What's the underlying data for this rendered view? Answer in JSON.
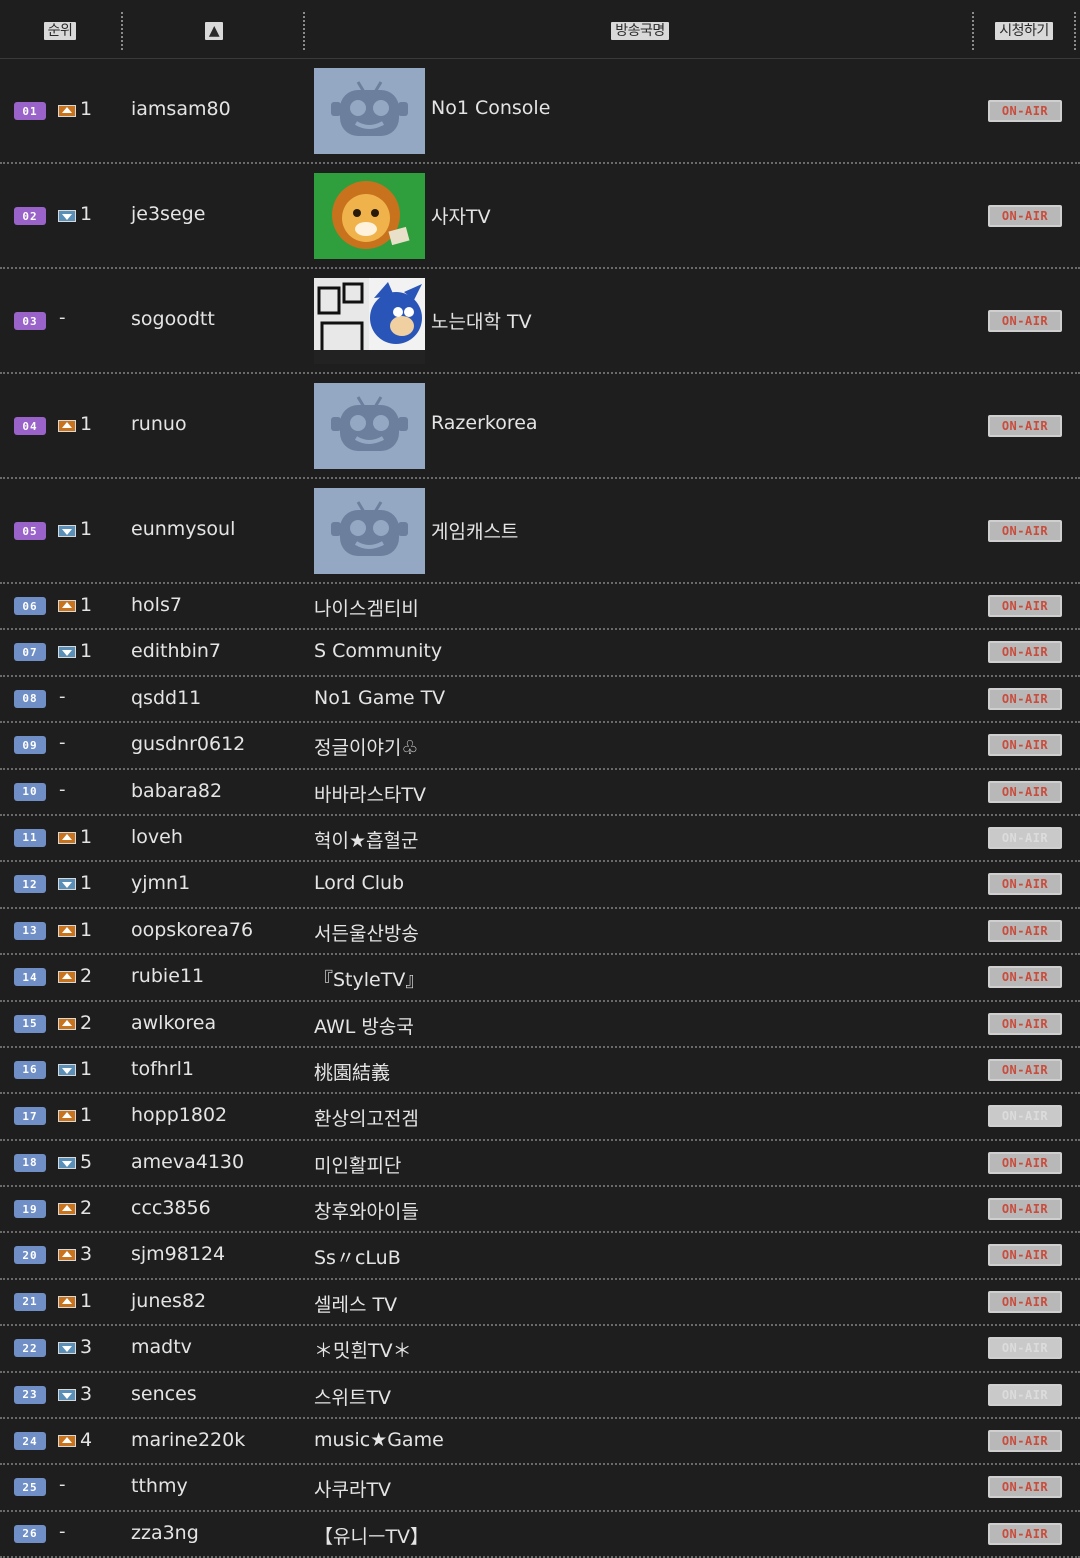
{
  "header": {
    "rank": "순위",
    "delta": "▲",
    "station": "방송국명",
    "watch": "시청하기"
  },
  "colors": {
    "purple_badge": "#9a63c9",
    "blue_badge": "#6f8fc6",
    "onair_red": "#c94c3c"
  },
  "rows": [
    {
      "rank": "01",
      "icon": "up-arrow-icon",
      "change": "1",
      "user": "iamsam80",
      "thumb": "tv-default",
      "station": "No1 Console",
      "onair": "ON-AIR",
      "active": true
    },
    {
      "rank": "02",
      "icon": "down-arrow-icon",
      "change": "1",
      "user": "je3sege",
      "thumb": "lion",
      "station": "사자TV",
      "onair": "ON-AIR",
      "active": true
    },
    {
      "rank": "03",
      "icon": "",
      "change": "-",
      "user": "sogoodtt",
      "thumb": "comic",
      "station": "노는대학 TV",
      "onair": "ON-AIR",
      "active": true
    },
    {
      "rank": "04",
      "icon": "up-arrow-icon",
      "change": "1",
      "user": "runuo",
      "thumb": "tv-default",
      "station": "Razerkorea",
      "onair": "ON-AIR",
      "active": true
    },
    {
      "rank": "05",
      "icon": "down-arrow-icon",
      "change": "1",
      "user": "eunmysoul",
      "thumb": "tv-default",
      "station": "게임캐스트",
      "onair": "ON-AIR",
      "active": true
    },
    {
      "rank": "06",
      "icon": "up-arrow-icon",
      "change": "1",
      "user": "hols7",
      "station": "나이스겜티비",
      "onair": "ON-AIR",
      "active": true
    },
    {
      "rank": "07",
      "icon": "down-arrow-icon",
      "change": "1",
      "user": "edithbin7",
      "station": "S Community",
      "onair": "ON-AIR",
      "active": true
    },
    {
      "rank": "08",
      "icon": "",
      "change": "-",
      "user": "qsdd11",
      "station": "No1 Game TV",
      "onair": "ON-AIR",
      "active": true
    },
    {
      "rank": "09",
      "icon": "",
      "change": "-",
      "user": "gusdnr0612",
      "station": "정글이야기♧",
      "onair": "ON-AIR",
      "active": true
    },
    {
      "rank": "10",
      "icon": "",
      "change": "-",
      "user": "babara82",
      "station": "바바라스타TV",
      "onair": "ON-AIR",
      "active": true
    },
    {
      "rank": "11",
      "icon": "up-arrow-icon",
      "change": "1",
      "user": "loveh",
      "station": "혁이★흡혈군",
      "onair": "ON-AIR",
      "active": false
    },
    {
      "rank": "12",
      "icon": "down-arrow-icon",
      "change": "1",
      "user": "yjmn1",
      "station": "Lord Club",
      "onair": "ON-AIR",
      "active": true
    },
    {
      "rank": "13",
      "icon": "up-arrow-icon",
      "change": "1",
      "user": "oopskorea76",
      "station": "서든울산방송",
      "onair": "ON-AIR",
      "active": true
    },
    {
      "rank": "14",
      "icon": "up-arrow-icon",
      "change": "2",
      "user": "rubie11",
      "station": "『StyleTV』",
      "onair": "ON-AIR",
      "active": true
    },
    {
      "rank": "15",
      "icon": "up-arrow-icon",
      "change": "2",
      "user": "awlkorea",
      "station": "AWL 방송국",
      "onair": "ON-AIR",
      "active": true
    },
    {
      "rank": "16",
      "icon": "down-arrow-icon",
      "change": "1",
      "user": "tofhrl1",
      "station": "桃園結義",
      "onair": "ON-AIR",
      "active": true
    },
    {
      "rank": "17",
      "icon": "up-arrow-icon",
      "change": "1",
      "user": "hopp1802",
      "station": "환상의고전겜",
      "onair": "ON-AIR",
      "active": false
    },
    {
      "rank": "18",
      "icon": "down-arrow-icon",
      "change": "5",
      "user": "ameva4130",
      "station": "미인활피단",
      "onair": "ON-AIR",
      "active": true
    },
    {
      "rank": "19",
      "icon": "up-arrow-icon",
      "change": "2",
      "user": "ccc3856",
      "station": "창후와아이들",
      "onair": "ON-AIR",
      "active": true
    },
    {
      "rank": "20",
      "icon": "up-arrow-icon",
      "change": "3",
      "user": "sjm98124",
      "station": "Ss〃cLuB",
      "onair": "ON-AIR",
      "active": true
    },
    {
      "rank": "21",
      "icon": "up-arrow-icon",
      "change": "1",
      "user": "junes82",
      "station": "셀레스 TV",
      "onair": "ON-AIR",
      "active": true
    },
    {
      "rank": "22",
      "icon": "down-arrow-icon",
      "change": "3",
      "user": "madtv",
      "station": "＊밋흰TV＊",
      "onair": "ON-AIR",
      "active": false
    },
    {
      "rank": "23",
      "icon": "down-arrow-icon",
      "change": "3",
      "user": "sences",
      "station": "스위트TV",
      "onair": "ON-AIR",
      "active": false
    },
    {
      "rank": "24",
      "icon": "up-arrow-icon",
      "change": "4",
      "user": "marine220k",
      "station": "music★Game",
      "onair": "ON-AIR",
      "active": true
    },
    {
      "rank": "25",
      "icon": "",
      "change": "-",
      "user": "tthmy",
      "station": "사쿠라TV",
      "onair": "ON-AIR",
      "active": true
    },
    {
      "rank": "26",
      "icon": "",
      "change": "-",
      "user": "zza3ng",
      "station": "【유니ㅡTV】",
      "onair": "ON-AIR",
      "active": true
    }
  ]
}
